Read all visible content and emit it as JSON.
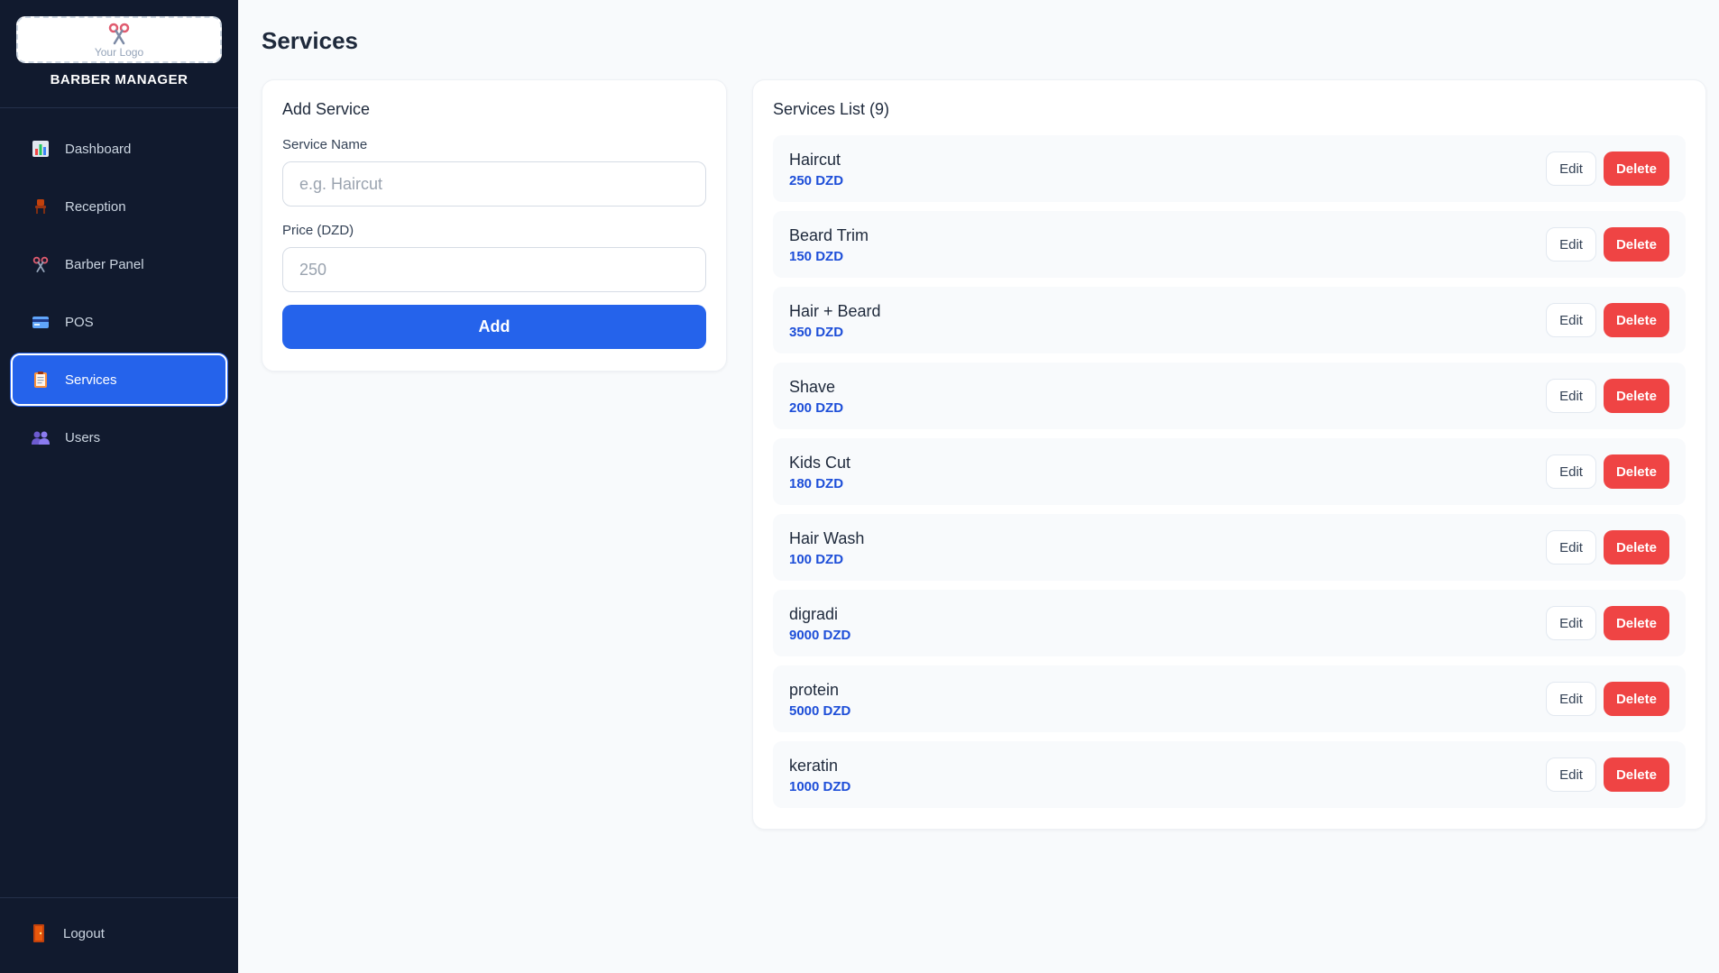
{
  "brand": {
    "logo_text": "Your Logo",
    "name": "BARBER MANAGER"
  },
  "sidebar": {
    "items": [
      {
        "label": "Dashboard",
        "icon": "chart-icon"
      },
      {
        "label": "Reception",
        "icon": "chair-icon"
      },
      {
        "label": "Barber Panel",
        "icon": "scissors-icon"
      },
      {
        "label": "POS",
        "icon": "credit-card-icon"
      },
      {
        "label": "Services",
        "icon": "clipboard-icon",
        "active": true
      },
      {
        "label": "Users",
        "icon": "users-icon"
      }
    ],
    "logout_label": "Logout"
  },
  "page": {
    "title": "Services"
  },
  "add_form": {
    "title": "Add Service",
    "name_label": "Service Name",
    "name_placeholder": "e.g. Haircut",
    "price_label": "Price (DZD)",
    "price_placeholder": "250",
    "submit_label": "Add"
  },
  "services": {
    "title": "Services List (9)",
    "edit_label": "Edit",
    "delete_label": "Delete",
    "items": [
      {
        "name": "Haircut",
        "price": "250 DZD"
      },
      {
        "name": "Beard Trim",
        "price": "150 DZD"
      },
      {
        "name": "Hair + Beard",
        "price": "350 DZD"
      },
      {
        "name": "Shave",
        "price": "200 DZD"
      },
      {
        "name": "Kids Cut",
        "price": "180 DZD"
      },
      {
        "name": "Hair Wash",
        "price": "100 DZD"
      },
      {
        "name": "digradi",
        "price": "9000 DZD"
      },
      {
        "name": "protein",
        "price": "5000 DZD"
      },
      {
        "name": "keratin",
        "price": "1000 DZD"
      }
    ]
  },
  "colors": {
    "sidebar_bg": "#111a2e",
    "accent": "#2563eb",
    "danger": "#ef4444",
    "price": "#1d4ed8"
  }
}
